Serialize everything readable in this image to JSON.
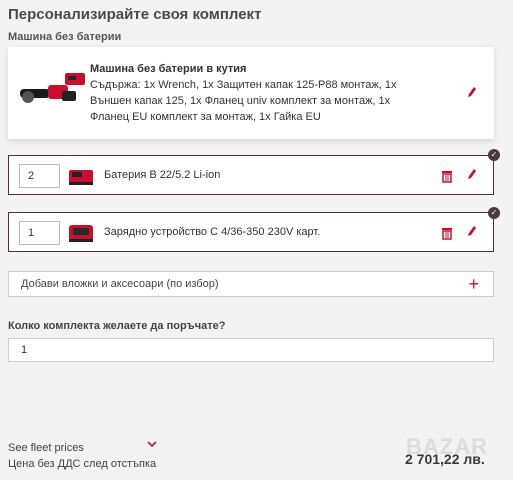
{
  "page": {
    "title": "Персонализирайте своя комплект",
    "subtitle": "Машина без батерии"
  },
  "machine": {
    "name": "Машина без батерии в кутия",
    "contents": "Съдържа: 1x Wrench, 1x Защитен капак 125-P88 монтаж, 1x Външен капак 125, 1x Фланец univ комплект за монтаж, 1x Фланец EU комплект за монтаж, 1x Гайка EU"
  },
  "items": [
    {
      "qty": "2",
      "label": "Батерия B 22/5.2 Li-ion"
    },
    {
      "qty": "1",
      "label": "Зарядно устройство C 4/36-350 230V карт."
    }
  ],
  "accessories": {
    "label": "Добави вложки и аксесоари (по избор)"
  },
  "order": {
    "question": "Колко комплекта желаете да поръчате?",
    "qty": "1"
  },
  "footer": {
    "fleet_label": "See fleet prices",
    "price_note": "Цена без ДДС след отстъпка",
    "price": "2 701,22 лв."
  },
  "colors": {
    "accent": "#c8102e",
    "border_dark": "#5a2a3a"
  },
  "icons": [
    "pencil-icon",
    "trash-icon",
    "check-icon",
    "plus-icon",
    "chevron-down-icon"
  ]
}
